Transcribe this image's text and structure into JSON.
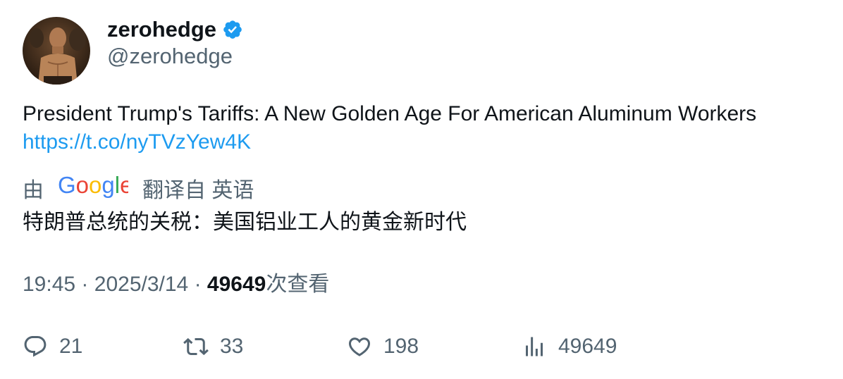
{
  "author": {
    "display_name": "zerohedge",
    "handle": "@zerohedge",
    "verified_icon": "verified-badge-icon",
    "avatar_icon": "avatar"
  },
  "tweet": {
    "text": "President Trump's Tariffs: A New Golden Age For American Aluminum Workers",
    "link": "https://t.co/nyTVzYew4K"
  },
  "translation": {
    "prefix": "由",
    "provider": "Google",
    "suffix": "翻译自 英语",
    "text": "特朗普总统的关税：美国铝业工人的黄金新时代"
  },
  "meta": {
    "time": "19:45",
    "date": "2025/3/14",
    "separator": "·",
    "views_count": "49649",
    "views_label": "次查看"
  },
  "actions": {
    "replies": "21",
    "retweets": "33",
    "likes": "198",
    "views": "49649"
  },
  "colors": {
    "link": "#1d9bf0",
    "secondary_text": "#536471",
    "primary_text": "#0f1419"
  }
}
